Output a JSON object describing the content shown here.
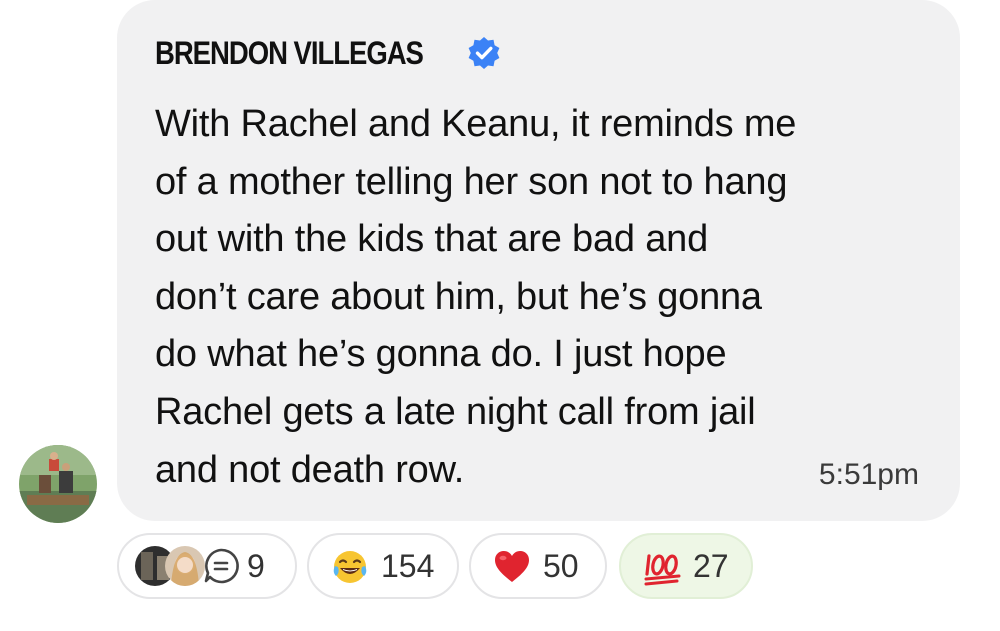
{
  "comment": {
    "author": "BRENDON VILLEGAS",
    "verified": true,
    "lines": [
      "With Rachel and Keanu, it reminds me",
      "of a mother telling her son not to hang",
      "out with the kids that are bad and",
      "don’t care about him, but he’s gonna",
      "do what he’s gonna do. I just hope",
      "Rachel gets a late night call from jail",
      "and not death row."
    ],
    "timestamp": "5:51pm"
  },
  "reactions": {
    "replies": {
      "icon": "reply-bubble-icon",
      "count": "9"
    },
    "laugh": {
      "icon": "laughing-emoji-icon",
      "count": "154"
    },
    "heart": {
      "icon": "red-heart-icon",
      "count": "50"
    },
    "hundred": {
      "icon": "hundred-points-icon",
      "count": "27"
    }
  },
  "colors": {
    "bubble": "#f1f1f2",
    "verified": "#3b82f6",
    "heart": "#e0242f",
    "hundred_pill": "#eef7e6"
  }
}
